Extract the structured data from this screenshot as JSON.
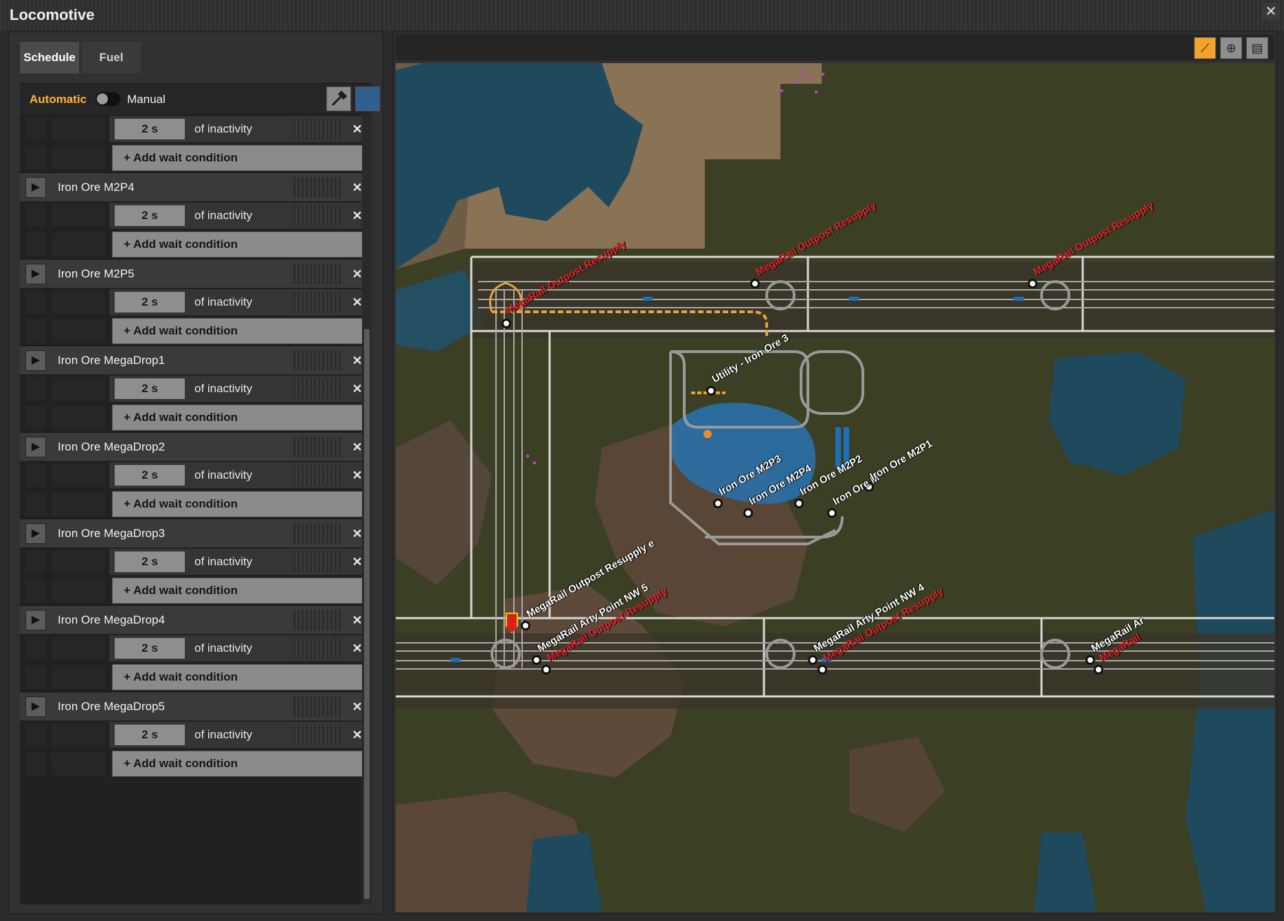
{
  "window": {
    "title": "Locomotive",
    "close_label": "✕"
  },
  "tabs": [
    {
      "label": "Schedule",
      "active": true
    },
    {
      "label": "Fuel",
      "active": false
    }
  ],
  "mode": {
    "automatic_label": "Automatic",
    "manual_label": "Manual",
    "is_automatic": true
  },
  "schedule": {
    "partial_top": {
      "condition": {
        "time": "2 s",
        "text": "of inactivity"
      },
      "add_label": "+ Add wait condition"
    },
    "stations": [
      {
        "name": "Iron Ore M2P4",
        "condition": {
          "time": "2 s",
          "text": "of inactivity"
        },
        "add_label": "+ Add wait condition"
      },
      {
        "name": "Iron Ore M2P5",
        "condition": {
          "time": "2 s",
          "text": "of inactivity"
        },
        "add_label": "+ Add wait condition"
      },
      {
        "name": "Iron Ore MegaDrop1",
        "condition": {
          "time": "2 s",
          "text": "of inactivity"
        },
        "add_label": "+ Add wait condition"
      },
      {
        "name": "Iron Ore MegaDrop2",
        "condition": {
          "time": "2 s",
          "text": "of inactivity"
        },
        "add_label": "+ Add wait condition"
      },
      {
        "name": "Iron Ore MegaDrop3",
        "condition": {
          "time": "2 s",
          "text": "of inactivity"
        },
        "add_label": "+ Add wait condition"
      },
      {
        "name": "Iron Ore MegaDrop4",
        "condition": {
          "time": "2 s",
          "text": "of inactivity"
        },
        "add_label": "+ Add wait condition"
      },
      {
        "name": "Iron Ore MegaDrop5",
        "condition": {
          "time": "2 s",
          "text": "of inactivity"
        },
        "add_label": "+ Add wait condition"
      }
    ]
  },
  "map": {
    "labels": [
      {
        "text": "MegaRail Outpost Resupply",
        "color": "red"
      },
      {
        "text": "MegaRail Outpost Resupply",
        "color": "red"
      },
      {
        "text": "MegaRail Outpost Resupply",
        "color": "red"
      },
      {
        "text": "Utility - Iron Ore 3",
        "color": "white"
      },
      {
        "text": "Iron Ore M2P3",
        "color": "white"
      },
      {
        "text": "Iron Ore M2P4",
        "color": "white"
      },
      {
        "text": "Iron Ore M2P2",
        "color": "white"
      },
      {
        "text": "Iron Ore M",
        "color": "white"
      },
      {
        "text": "Iron Ore M2P1",
        "color": "white"
      },
      {
        "text": "MegaRail Outpost Resupply e",
        "color": "white"
      },
      {
        "text": "MegaRail Arty Point NW 5",
        "color": "white"
      },
      {
        "text": "MegaRail Outpost Resupply",
        "color": "red"
      },
      {
        "text": "MegaRail Arty Point NW 4",
        "color": "white"
      },
      {
        "text": "MegaRail Outpost Resupply",
        "color": "red"
      },
      {
        "text": "MegaRail Ar",
        "color": "white"
      },
      {
        "text": "MegaRail",
        "color": "red"
      }
    ],
    "colors": {
      "water": "#1f4a5e",
      "grass": "#3b3f24",
      "dirt": "#5a4636",
      "sand": "#8a7355",
      "rail": "#bdbdbd",
      "path": "#e8a33a"
    }
  },
  "icons": {
    "play": "play-icon",
    "remove": "close-icon",
    "pipette": "eyedropper-icon",
    "tool1": "rail-path-icon",
    "tool2": "target-icon",
    "tool3": "map-icon"
  }
}
